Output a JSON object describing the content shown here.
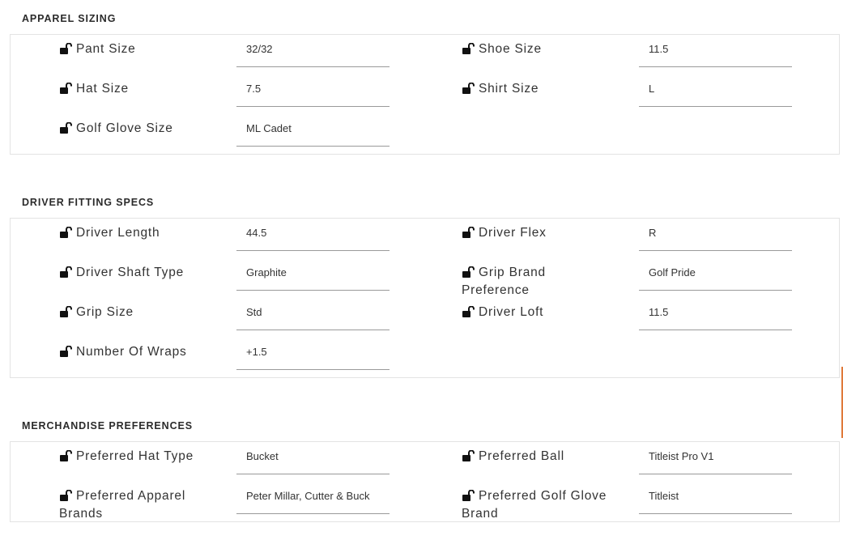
{
  "colors": {
    "text": "#333333",
    "panel_border": "#e3e3e3",
    "input_underline": "#9a9a9a",
    "accent": "#e07a3a"
  },
  "sections": [
    {
      "title": "APPAREL SIZING",
      "fields": [
        {
          "label": "Pant Size",
          "value": "32/32",
          "icon": "unlock-icon"
        },
        {
          "label": "Shoe Size",
          "value": "11.5",
          "icon": "unlock-icon"
        },
        {
          "label": "Hat Size",
          "value": "7.5",
          "icon": "unlock-icon"
        },
        {
          "label": "Shirt Size",
          "value": "L",
          "icon": "unlock-icon"
        },
        {
          "label": "Golf Glove Size",
          "value": "ML Cadet",
          "icon": "unlock-icon"
        }
      ]
    },
    {
      "title": "DRIVER FITTING SPECS",
      "fields": [
        {
          "label": "Driver Length",
          "value": "44.5",
          "icon": "unlock-icon"
        },
        {
          "label": "Driver Flex",
          "value": "R",
          "icon": "unlock-icon"
        },
        {
          "label": "Driver Shaft Type",
          "value": "Graphite",
          "icon": "unlock-icon"
        },
        {
          "label": "Grip Brand Preference",
          "value": "Golf Pride",
          "icon": "unlock-icon"
        },
        {
          "label": "Grip Size",
          "value": "Std",
          "icon": "unlock-icon"
        },
        {
          "label": "Driver Loft",
          "value": "11.5",
          "icon": "unlock-icon"
        },
        {
          "label": "Number Of Wraps",
          "value": "+1.5",
          "icon": "unlock-icon"
        }
      ]
    },
    {
      "title": "MERCHANDISE PREFERENCES",
      "fields": [
        {
          "label": "Preferred Hat Type",
          "value": "Bucket",
          "icon": "unlock-icon"
        },
        {
          "label": "Preferred Ball",
          "value": "Titleist Pro V1",
          "icon": "unlock-icon"
        },
        {
          "label": "Preferred Apparel Brands",
          "value": "Peter Millar, Cutter & Buck",
          "icon": "unlock-icon"
        },
        {
          "label": "Preferred Golf Glove Brand",
          "value": "Titleist",
          "icon": "unlock-icon"
        }
      ]
    }
  ]
}
